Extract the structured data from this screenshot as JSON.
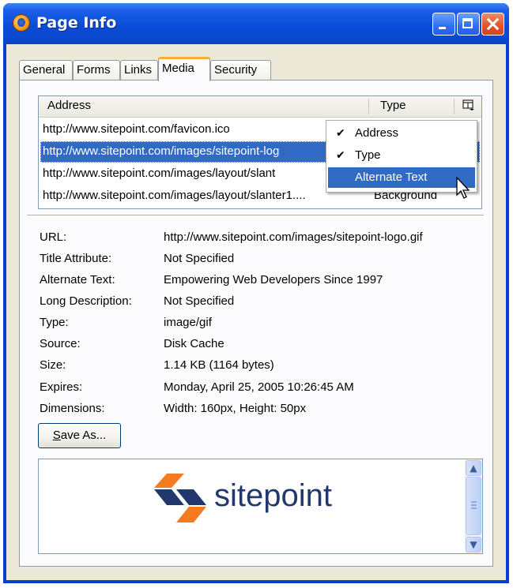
{
  "window": {
    "title": "Page Info"
  },
  "tabs": [
    {
      "label": "General",
      "active": false
    },
    {
      "label": "Forms",
      "active": false
    },
    {
      "label": "Links",
      "active": false
    },
    {
      "label": "Media",
      "active": true
    },
    {
      "label": "Security",
      "active": false
    }
  ],
  "media_list": {
    "columns": {
      "address": "Address",
      "type": "Type",
      "picker_icon": "column-picker-icon"
    },
    "rows": [
      {
        "address": "http://www.sitepoint.com/favicon.ico",
        "type": "",
        "selected": false
      },
      {
        "address": "http://www.sitepoint.com/images/sitepoint-log",
        "type": "",
        "selected": true
      },
      {
        "address": "http://www.sitepoint.com/images/layout/slant",
        "type": "",
        "selected": false
      },
      {
        "address": "http://www.sitepoint.com/images/layout/slanter1....",
        "type": "Background",
        "selected": false
      }
    ]
  },
  "column_menu": [
    {
      "label": "Address",
      "checked": true,
      "check_glyph": "✔"
    },
    {
      "label": "Type",
      "checked": true,
      "check_glyph": "✔"
    },
    {
      "label": "Alternate Text",
      "checked": false,
      "highlighted": true,
      "check_glyph": ""
    }
  ],
  "properties": [
    {
      "label": "URL:",
      "value": "http://www.sitepoint.com/images/sitepoint-logo.gif"
    },
    {
      "label": "Title Attribute:",
      "value": "Not Specified"
    },
    {
      "label": "Alternate Text:",
      "value": "Empowering Web Developers Since 1997"
    },
    {
      "label": "Long Description:",
      "value": "Not Specified"
    },
    {
      "label": "Type:",
      "value": "image/gif"
    },
    {
      "label": "Source:",
      "value": "Disk Cache"
    },
    {
      "label": "Size:",
      "value": "1.14 KB (1164 bytes)"
    },
    {
      "label": "Expires:",
      "value": "Monday, April 25, 2005 10:26:45 AM"
    },
    {
      "label": "Dimensions:",
      "value": "Width: 160px, Height: 50px"
    }
  ],
  "save_button": {
    "mnemonic": "S",
    "rest": "ave As..."
  },
  "preview": {
    "logo_text": "sitepoint",
    "up_glyph": "▲",
    "down_glyph": "▼"
  },
  "colors": {
    "titlebar": "#0a4cd8",
    "selection": "#316ac5",
    "logo_navy": "#22386c",
    "logo_orange": "#f47b20"
  }
}
